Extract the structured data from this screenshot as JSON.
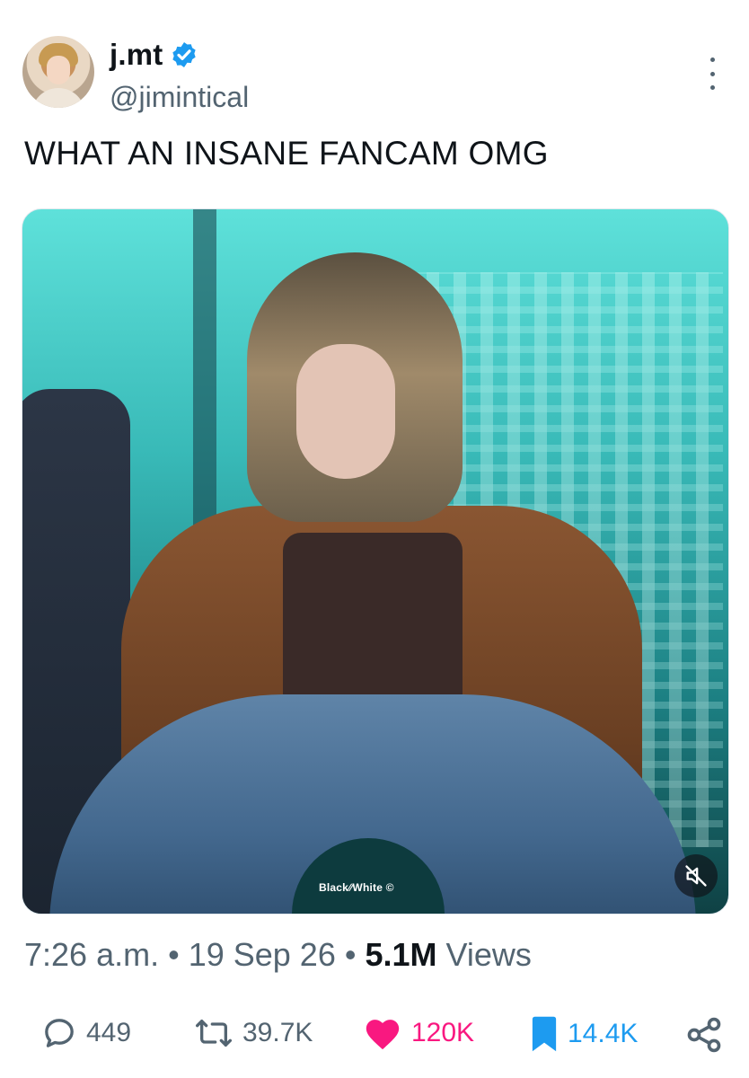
{
  "author": {
    "display_name": "j.mt",
    "handle": "@jimintical",
    "verified": true
  },
  "tweet": {
    "text": "WHAT AN INSANE FANCAM OMG"
  },
  "media": {
    "watermark": "Black∕∕White ©",
    "muted": true
  },
  "meta": {
    "time": "7:26 a.m.",
    "separator": " • ",
    "date": "19 Sep 26",
    "views_count": "5.1M",
    "views_label": " Views"
  },
  "actions": {
    "replies": "449",
    "reposts": "39.7K",
    "likes": "120K",
    "bookmarks": "14.4K"
  },
  "colors": {
    "verified_blue": "#1d9bf0",
    "like_pink": "#f91880",
    "secondary_text": "#536471",
    "primary_text": "#0f1419"
  },
  "icons": {
    "verified": "verified-badge-icon",
    "more": "more-options-icon",
    "mute": "speaker-muted-icon",
    "reply": "reply-icon",
    "repost": "repost-icon",
    "like": "heart-icon",
    "bookmark": "bookmark-icon",
    "share": "share-icon"
  }
}
